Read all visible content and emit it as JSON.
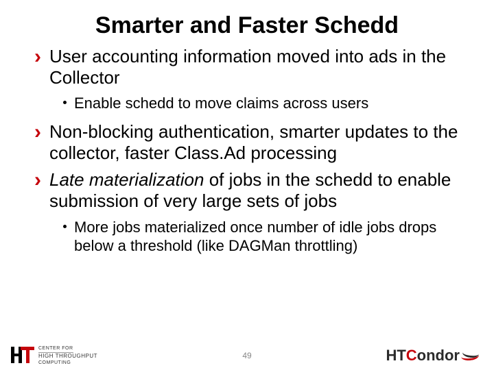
{
  "title": "Smarter and Faster Schedd",
  "bullets": [
    {
      "text": "User accounting information moved into ads in the Collector",
      "sub": [
        "Enable schedd to move claims across users"
      ]
    },
    {
      "text": "Non-blocking authentication, smarter updates to the collector, faster Class.Ad processing"
    },
    {
      "html": "<span class='italic'>Late materialization</span> of jobs in the schedd to enable submission of very large sets of jobs",
      "sub": [
        "More jobs materialized once number of idle jobs drops below a threshold (like DAGMan throttling)"
      ]
    }
  ],
  "page_number": "49",
  "logo_left": {
    "line1": "CENTER FOR",
    "line2": "HIGH THROUGHPUT",
    "line3": "COMPUTING"
  },
  "logo_right": {
    "part1": "HT",
    "part2": "C",
    "part3": "ondor"
  }
}
